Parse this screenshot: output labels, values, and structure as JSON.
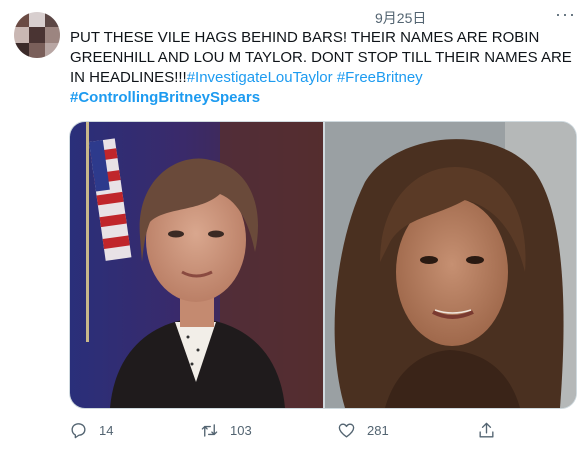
{
  "tweet": {
    "date": "9月25日",
    "more": "···",
    "text_main": "PUT THESE VILE HAGS BEHIND BARS! THEIR NAMES ARE ROBIN GREENHILL AND LOU M TAYLOR. DONT STOP TILL THEIR NAMES ARE IN HEADLINES!!!",
    "hashtags": [
      "#InvestigateLouTaylor",
      "#FreeBritney"
    ],
    "hashtag_bold": "#ControllingBritneySpears"
  },
  "actions": {
    "reply_count": "14",
    "retweet_count": "103",
    "like_count": "281"
  },
  "icons": [
    "reply-icon",
    "retweet-icon",
    "like-icon",
    "share-icon",
    "more-icon"
  ],
  "colors": {
    "link": "#1d9bf0",
    "muted": "#536471",
    "border": "#cfd9de"
  }
}
